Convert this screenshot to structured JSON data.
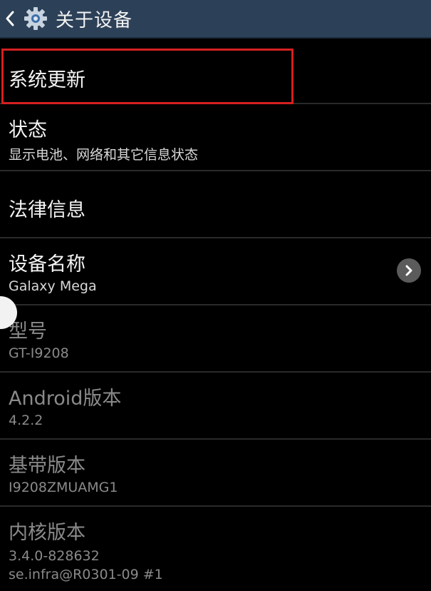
{
  "action_bar": {
    "back_icon": "chevron-left-icon",
    "app_icon": "gear-icon",
    "title": "关于设备",
    "background": "#2c4158"
  },
  "items": [
    {
      "title": "系统更新",
      "subtitle": "",
      "highlighted": true
    },
    {
      "title": "状态",
      "subtitle": "显示电池、网络和其它信息状态"
    },
    {
      "title": "法律信息",
      "subtitle": ""
    },
    {
      "title": "设备名称",
      "subtitle": "Galaxy Mega",
      "trailing_icon": "chevron-right-icon"
    },
    {
      "title": "型号",
      "subtitle": "GT-I9208"
    },
    {
      "title": "Android版本",
      "subtitle": "4.2.2"
    },
    {
      "title": "基带版本",
      "subtitle": "I9208ZMUAMG1"
    },
    {
      "title": "内核版本",
      "subtitle_line1": "3.4.0-828632",
      "subtitle_line2": "se.infra@R0301-09 #1"
    }
  ],
  "colors": {
    "highlight": "#d52020",
    "divider": "#2a2a2a"
  }
}
